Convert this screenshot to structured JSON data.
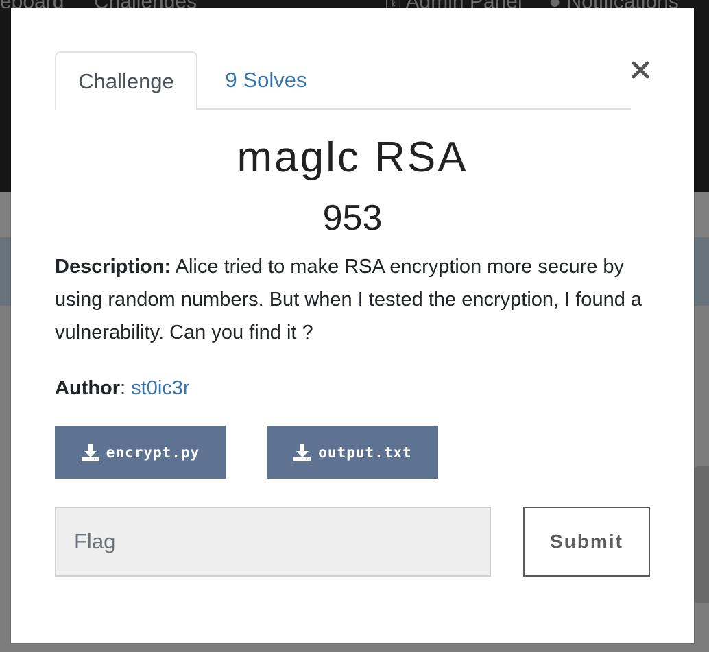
{
  "background_nav": {
    "link_1": "reboard",
    "link_2": "Challenges",
    "link_3": "Admin Panel",
    "link_4": "Notifications"
  },
  "modal": {
    "tabs": [
      {
        "label": "Challenge",
        "active": true
      },
      {
        "label": "9 Solves",
        "active": false
      }
    ],
    "close_icon": "close-icon",
    "title": "maglc RSA",
    "value": "953",
    "description_label": "Description:",
    "description_text": " Alice tried to make RSA encryption more secure by using random numbers. But when I tested the encryption, I found a vulnerability. Can you find it ?",
    "author_label": "Author",
    "author_sep": ": ",
    "author_name": "st0ic3r",
    "files": [
      {
        "label": "encrypt.py",
        "icon": "download-icon"
      },
      {
        "label": "output.txt",
        "icon": "download-icon"
      }
    ],
    "flag_input": {
      "placeholder": "Flag",
      "value": ""
    },
    "submit_label": "Submit"
  },
  "colors": {
    "link_blue": "#3775ad",
    "file_button_bg": "#5e7391",
    "navbar_bg": "#161616"
  }
}
